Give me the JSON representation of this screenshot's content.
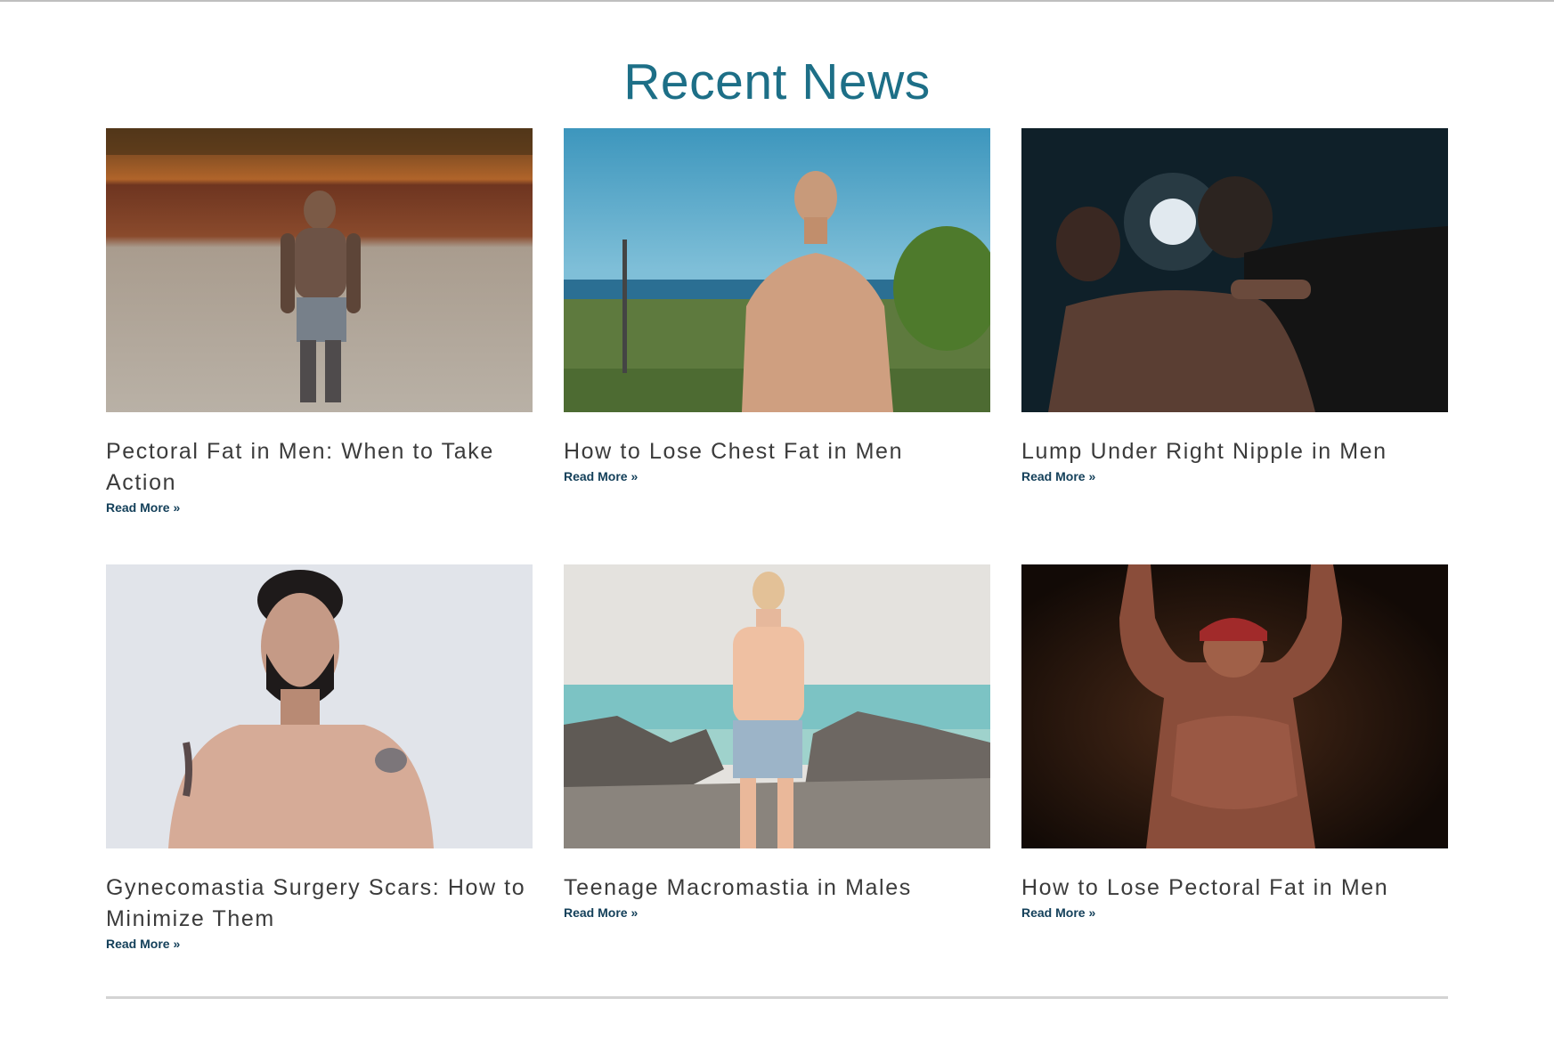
{
  "section": {
    "title": "Recent News",
    "title_color": "#1d6f87"
  },
  "posts": [
    {
      "title": "Pectoral Fat in Men: When to Take Action",
      "read_more": "Read More »",
      "image_icon": "photo-tattooed-man-on-riverbank"
    },
    {
      "title": "How to Lose Chest Fat in Men",
      "read_more": "Read More »",
      "image_icon": "photo-man-by-sea-in-sun"
    },
    {
      "title": "Lump Under Right Nipple in Men",
      "read_more": "Read More »",
      "image_icon": "photo-tattoo-artist-at-work"
    },
    {
      "title": "Gynecomastia Surgery Scars: How to Minimize Them",
      "read_more": "Read More »",
      "image_icon": "photo-bearded-man-portrait"
    },
    {
      "title": "Teenage Macromastia in Males",
      "read_more": "Read More »",
      "image_icon": "photo-young-man-on-rocky-beach"
    },
    {
      "title": "How to Lose Pectoral Fat in Men",
      "read_more": "Read More »",
      "image_icon": "photo-man-arms-raised-dark"
    }
  ],
  "colors": {
    "link": "#14405a",
    "title_text": "#3b3b3b",
    "divider": "#d4d4d4"
  }
}
